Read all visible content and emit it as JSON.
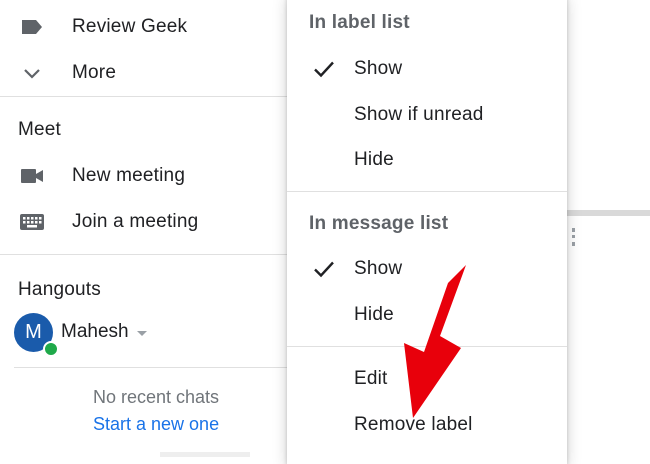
{
  "sidebar": {
    "labels": [
      {
        "label": "Review Geek",
        "icon": "label-tag-icon"
      },
      {
        "label": "More",
        "icon": "chevron-down-icon"
      }
    ],
    "meet": {
      "title": "Meet",
      "items": [
        {
          "label": "New meeting",
          "icon": "videocam-icon"
        },
        {
          "label": "Join a meeting",
          "icon": "keyboard-icon"
        }
      ]
    },
    "hangouts": {
      "title": "Hangouts",
      "avatar_initial": "M",
      "user_name": "Mahesh",
      "empty_text": "No recent chats",
      "start_link": "Start a new one"
    }
  },
  "menu": {
    "label_list": {
      "heading": "In label list",
      "options": [
        {
          "label": "Show",
          "checked": true
        },
        {
          "label": "Show if unread",
          "checked": false
        },
        {
          "label": "Hide",
          "checked": false
        }
      ]
    },
    "message_list": {
      "heading": "In message list",
      "options": [
        {
          "label": "Show",
          "checked": true
        },
        {
          "label": "Hide",
          "checked": false
        }
      ]
    },
    "actions": [
      {
        "label": "Edit"
      },
      {
        "label": "Remove label"
      }
    ]
  },
  "colors": {
    "accent_link": "#1a73e8",
    "avatar_bg": "#1a5bab",
    "presence_online": "#1fa94a",
    "annotation_arrow": "#e8000b",
    "menu_heading": "#5f6368",
    "icon_gray": "#5f6368"
  }
}
